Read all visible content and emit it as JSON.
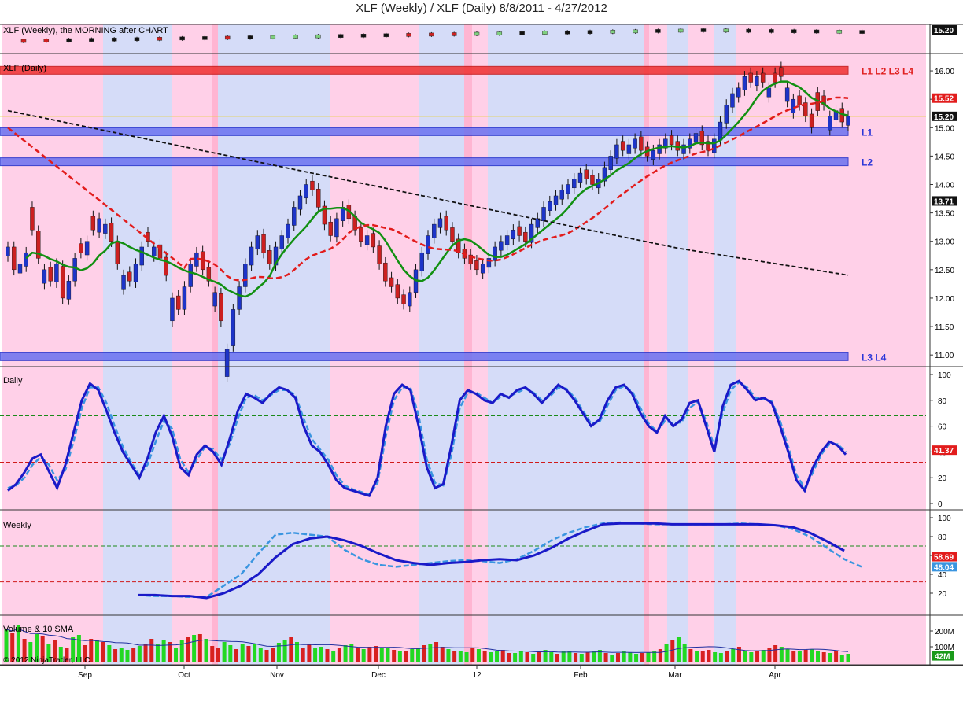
{
  "title": "XLF (Weekly) / XLF (Daily)  8/8/2011 - 4/27/2012",
  "colors": {
    "bg_pink": "#ffd0e8",
    "bg_pink_dark": "#ffb5d2",
    "bg_blue": "#d5dcf8",
    "bullish_candle": "#1d34c8",
    "bearish_candle": "#cc2020",
    "sma_green": "#129012",
    "sma_red": "#e21c1c",
    "sma_navy": "#1a2a8a",
    "sma_black": "#111111",
    "sma_purple": "#8a2aa0",
    "stoch_k": "#1a1ac8",
    "stoch_d": "#3a95e0",
    "stoch_slow_red": "#e21c1c",
    "overbought_line": "#1a8a1a",
    "oversold_line": "#d01a1a"
  },
  "chart_data": [
    {
      "type": "candlestick",
      "panel": "weekly-candles",
      "label": "XLF (Weekly), the MORNING after CHART",
      "price_tag": "15.20",
      "candles": [
        {
          "w": 0,
          "c": "red"
        },
        {
          "w": 1,
          "c": "red"
        },
        {
          "w": 2,
          "c": "black"
        },
        {
          "w": 3,
          "c": "black"
        },
        {
          "w": 4,
          "c": "black"
        },
        {
          "w": 5,
          "c": "black"
        },
        {
          "w": 6,
          "c": "red"
        },
        {
          "w": 7,
          "c": "black"
        },
        {
          "w": 8,
          "c": "black"
        },
        {
          "w": 9,
          "c": "red"
        },
        {
          "w": 10,
          "c": "black"
        },
        {
          "w": 11,
          "c": "green"
        },
        {
          "w": 12,
          "c": "green"
        },
        {
          "w": 13,
          "c": "green"
        },
        {
          "w": 14,
          "c": "black"
        },
        {
          "w": 15,
          "c": "black"
        },
        {
          "w": 16,
          "c": "black"
        },
        {
          "w": 17,
          "c": "red"
        },
        {
          "w": 18,
          "c": "red"
        },
        {
          "w": 19,
          "c": "red"
        },
        {
          "w": 20,
          "c": "green"
        },
        {
          "w": 21,
          "c": "green"
        },
        {
          "w": 22,
          "c": "black"
        },
        {
          "w": 23,
          "c": "green"
        },
        {
          "w": 24,
          "c": "black"
        },
        {
          "w": 25,
          "c": "black"
        },
        {
          "w": 26,
          "c": "green"
        },
        {
          "w": 27,
          "c": "green"
        },
        {
          "w": 28,
          "c": "black"
        },
        {
          "w": 29,
          "c": "green"
        },
        {
          "w": 30,
          "c": "black"
        },
        {
          "w": 31,
          "c": "green"
        },
        {
          "w": 32,
          "c": "black"
        },
        {
          "w": 33,
          "c": "black"
        },
        {
          "w": 34,
          "c": "black"
        },
        {
          "w": 35,
          "c": "black"
        },
        {
          "w": 36,
          "c": "green"
        },
        {
          "w": 37,
          "c": "black"
        }
      ]
    },
    {
      "type": "candlestick",
      "panel": "daily-price",
      "label": "XLF (Daily)",
      "ylim": [
        10.85,
        16.25
      ],
      "y_ticks": [
        "16.00",
        "15.50",
        "15.00",
        "14.50",
        "14.00",
        "13.50",
        "13.00",
        "12.50",
        "12.00",
        "11.50",
        "11.00"
      ],
      "x_ticks": [
        "Sep",
        "Oct",
        "Nov",
        "Dec",
        "12",
        "Feb",
        "Mar",
        "Apr"
      ],
      "price_tags": [
        {
          "label": "15.52",
          "value": 15.52,
          "color": "#e21c1c"
        },
        {
          "label": "15.20",
          "value": 15.2,
          "color": "#111111"
        },
        {
          "label": "13.71",
          "value": 13.71,
          "color": "#111111"
        }
      ],
      "levels": [
        {
          "label": "L1 L2 L3 L4",
          "value": 16.01,
          "color": "#e02020",
          "band": "red"
        },
        {
          "label": "L1",
          "value": 14.93,
          "color": "#2a35d8",
          "band": "blue"
        },
        {
          "label": "L2",
          "value": 14.4,
          "color": "#2a35d8",
          "band": "blue"
        },
        {
          "label": "L3 L4",
          "value": 10.97,
          "color": "#2a35d8",
          "band": "blue"
        }
      ],
      "closes": [
        12.9,
        12.5,
        12.6,
        12.8,
        13.2,
        12.7,
        12.5,
        12.3,
        12.6,
        12.0,
        12.3,
        12.7,
        12.8,
        13.0,
        13.2,
        13.4,
        13.3,
        13.0,
        12.6,
        12.4,
        12.3,
        12.6,
        12.9,
        13.0,
        12.9,
        12.7,
        12.4,
        12.0,
        11.8,
        12.2,
        12.6,
        12.8,
        12.5,
        12.3,
        12.1,
        11.6,
        11.1,
        11.8,
        12.2,
        12.6,
        12.9,
        13.1,
        12.8,
        12.6,
        12.9,
        13.1,
        13.3,
        13.6,
        13.8,
        14.0,
        13.9,
        13.6,
        13.3,
        13.1,
        13.4,
        13.6,
        13.4,
        13.2,
        13.0,
        13.1,
        12.9,
        12.6,
        12.3,
        12.2,
        12.0,
        11.9,
        12.1,
        12.5,
        12.8,
        13.1,
        13.3,
        13.4,
        13.2,
        13.0,
        12.8,
        12.7,
        12.6,
        12.5,
        12.6,
        12.7,
        12.9,
        13.0,
        13.1,
        13.2,
        13.1,
        13.0,
        13.3,
        13.4,
        13.6,
        13.7,
        13.8,
        13.9,
        14.0,
        14.1,
        14.2,
        14.1,
        14.0,
        14.1,
        14.3,
        14.5,
        14.7,
        14.6,
        14.7,
        14.8,
        14.6,
        14.5,
        14.6,
        14.7,
        14.8,
        14.7,
        14.6,
        14.7,
        14.8,
        14.9,
        14.7,
        14.6,
        14.8,
        15.1,
        15.4,
        15.6,
        15.7,
        15.9,
        15.8,
        15.9,
        15.8,
        15.7,
        15.8,
        15.9,
        15.7,
        15.5,
        15.4,
        15.2,
        15.0,
        15.3,
        15.4,
        15.2,
        15.3,
        15.1,
        15.2
      ],
      "candle_color_pattern": [
        1,
        0,
        1,
        1,
        0,
        0,
        1,
        0,
        1,
        0,
        1,
        1,
        0,
        1,
        0,
        1,
        1,
        0,
        0,
        1,
        0,
        1,
        1,
        0,
        1,
        0,
        0,
        1,
        0,
        1,
        1,
        1,
        0,
        0,
        1,
        0,
        1,
        1,
        1,
        1,
        1,
        1,
        0,
        0,
        1,
        1,
        1,
        1,
        1,
        1,
        0,
        0,
        0,
        0,
        1,
        1,
        0,
        0,
        0,
        1,
        0,
        0,
        0,
        0,
        0,
        0,
        1,
        1,
        1,
        1,
        1,
        1,
        0,
        0,
        0,
        0,
        0,
        0,
        1,
        1,
        1,
        1,
        1,
        1,
        0,
        0,
        1,
        1,
        1,
        1,
        1,
        1,
        1,
        1,
        1,
        0,
        0,
        1,
        1,
        1,
        1,
        0,
        1,
        1,
        0,
        0,
        1,
        1,
        1,
        0,
        0,
        1,
        1,
        1,
        0,
        0,
        1,
        1,
        1,
        1,
        1,
        1,
        0,
        1,
        0,
        1,
        0,
        0,
        1,
        1,
        0,
        0,
        0,
        0,
        0,
        1,
        1,
        0,
        1,
        0,
        1
      ]
    },
    {
      "type": "line",
      "panel": "daily-stochastic",
      "label": "Daily",
      "ylim": [
        0,
        100
      ],
      "y_ticks": [
        "100",
        "80",
        "60",
        "40",
        "20",
        "0"
      ],
      "overbought": 68,
      "oversold": 32,
      "value_tags": [
        {
          "label": "41.37",
          "value": 41.37
        }
      ],
      "series_k": [
        10,
        15,
        24,
        35,
        38,
        25,
        12,
        30,
        55,
        80,
        93,
        88,
        72,
        55,
        40,
        30,
        20,
        35,
        55,
        68,
        52,
        28,
        22,
        38,
        45,
        40,
        30,
        50,
        72,
        85,
        82,
        78,
        85,
        90,
        88,
        82,
        60,
        45,
        40,
        30,
        18,
        12,
        10,
        8,
        6,
        20,
        60,
        85,
        92,
        88,
        60,
        28,
        12,
        15,
        45,
        80,
        88,
        85,
        80,
        78,
        85,
        82,
        88,
        90,
        85,
        78,
        85,
        92,
        88,
        80,
        70,
        60,
        65,
        80,
        90,
        92,
        85,
        70,
        60,
        55,
        68,
        60,
        65,
        78,
        80,
        60,
        40,
        75,
        92,
        95,
        88,
        80,
        82,
        78,
        60,
        40,
        18,
        10,
        28,
        40,
        48,
        45,
        38
      ],
      "series_d": [
        12,
        14,
        20,
        30,
        36,
        30,
        18,
        26,
        48,
        74,
        90,
        90,
        78,
        60,
        44,
        32,
        22,
        30,
        48,
        64,
        58,
        34,
        24,
        34,
        44,
        42,
        34,
        46,
        66,
        82,
        84,
        80,
        84,
        88,
        88,
        84,
        66,
        50,
        42,
        34,
        22,
        14,
        11,
        9,
        7,
        16,
        52,
        80,
        90,
        90,
        68,
        34,
        16,
        14,
        38,
        74,
        86,
        86,
        82,
        78,
        83,
        83,
        86,
        89,
        86,
        80,
        83,
        90,
        89,
        82,
        72,
        62,
        63,
        76,
        88,
        91,
        87,
        74,
        62,
        56,
        64,
        62,
        63,
        74,
        79,
        64,
        44,
        70,
        88,
        94,
        90,
        82,
        81,
        79,
        64,
        44,
        22,
        12,
        24,
        38,
        46,
        46,
        40
      ]
    },
    {
      "type": "line",
      "panel": "weekly-stochastic",
      "label": "Weekly",
      "ylim": [
        0,
        100
      ],
      "y_ticks": [
        "100",
        "80",
        "60",
        "40",
        "20"
      ],
      "overbought": 70,
      "oversold": 32,
      "value_tags": [
        {
          "label": "58.69",
          "value": 58.69
        },
        {
          "label": "48.04",
          "value": 48.04
        }
      ],
      "series_k": [
        18,
        18,
        17,
        17,
        15,
        20,
        28,
        40,
        58,
        72,
        78,
        80,
        76,
        70,
        62,
        55,
        52,
        50,
        52,
        53,
        55,
        56,
        55,
        60,
        68,
        78,
        86,
        93,
        94,
        94,
        94,
        93,
        93,
        93,
        93,
        93,
        93,
        92,
        90,
        84,
        75,
        65
      ],
      "series_d": [
        18,
        17,
        17,
        16,
        16,
        28,
        40,
        62,
        82,
        84,
        82,
        80,
        66,
        56,
        50,
        48,
        50,
        52,
        54,
        55,
        54,
        52,
        56,
        65,
        76,
        84,
        90,
        94,
        95,
        94,
        93,
        93,
        93,
        93,
        93,
        94,
        93,
        92,
        88,
        80,
        68,
        56,
        48
      ]
    },
    {
      "type": "bar",
      "panel": "volume",
      "label": "Volume & 10 SMA",
      "y_ticks": [
        "200M",
        "100M"
      ],
      "value_tags": [
        {
          "label": "42M",
          "value": 42
        }
      ],
      "values": [
        210,
        190,
        240,
        150,
        130,
        180,
        170,
        120,
        145,
        100,
        95,
        160,
        175,
        110,
        150,
        145,
        130,
        110,
        85,
        95,
        80,
        90,
        105,
        115,
        150,
        120,
        145,
        130,
        90,
        140,
        160,
        175,
        180,
        150,
        105,
        95,
        130,
        110,
        85,
        120,
        105,
        115,
        95,
        80,
        90,
        125,
        145,
        160,
        130,
        90,
        115,
        95,
        100,
        85,
        75,
        90,
        110,
        120,
        95,
        85,
        100,
        105,
        95,
        90,
        80,
        75,
        70,
        85,
        95,
        110,
        120,
        130,
        100,
        85,
        70,
        75,
        65,
        90,
        85,
        70,
        65,
        75,
        80,
        60,
        60,
        70,
        65,
        55,
        70,
        80,
        65,
        55,
        70,
        75,
        60,
        55,
        65,
        70,
        80,
        60,
        50,
        60,
        70,
        65,
        55,
        60,
        65,
        70,
        85,
        120,
        140,
        160,
        120,
        85,
        70,
        75,
        80,
        65,
        60,
        70,
        85,
        100,
        75,
        65,
        70,
        80,
        90,
        110,
        100,
        85,
        70,
        75,
        80,
        85,
        70,
        65,
        60,
        75,
        50,
        55
      ],
      "up_pattern": [
        1,
        0,
        1,
        0,
        1,
        1,
        0,
        1,
        0,
        1,
        0,
        1,
        1,
        0,
        0,
        1,
        0,
        1,
        0,
        1,
        1,
        0,
        1,
        0,
        0,
        1,
        1,
        0,
        1,
        1,
        0,
        1,
        0,
        1,
        0,
        0,
        1,
        1,
        0,
        1,
        0,
        1,
        1,
        0,
        0,
        1,
        1,
        0,
        1,
        0,
        0,
        1,
        1,
        0,
        1,
        0,
        1,
        1,
        0,
        1,
        0,
        0,
        1,
        1,
        0,
        1,
        0,
        1,
        1,
        0,
        1,
        0,
        0,
        1,
        0,
        1,
        1,
        0,
        1,
        0,
        1,
        1,
        0,
        0,
        1,
        1,
        0,
        1,
        0,
        1,
        1,
        0,
        1,
        1,
        0,
        1,
        0,
        1,
        1,
        0,
        1,
        0,
        1,
        1,
        1,
        0,
        1,
        1,
        0,
        1,
        0,
        1,
        1,
        0,
        1,
        0,
        0,
        1,
        1,
        0,
        1,
        0,
        1,
        1,
        0,
        1,
        0,
        0,
        1,
        1,
        0,
        1,
        0,
        1,
        1,
        0,
        1,
        0,
        1,
        1
      ],
      "copyright": "© 2012 NinjaTrader, LLC"
    }
  ]
}
